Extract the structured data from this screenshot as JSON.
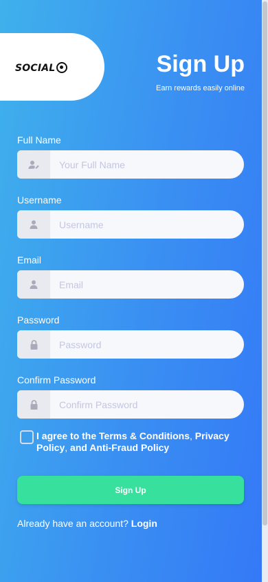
{
  "logo": {
    "text": "SOCIAL"
  },
  "header": {
    "title": "Sign Up",
    "subtitle": "Earn rewards easily online"
  },
  "form": {
    "fields": [
      {
        "label": "Full Name",
        "placeholder": "Your Full Name",
        "icon": "user-edit-icon"
      },
      {
        "label": "Username",
        "placeholder": "Username",
        "icon": "user-icon"
      },
      {
        "label": "Email",
        "placeholder": "Email",
        "icon": "user-icon"
      },
      {
        "label": "Password",
        "placeholder": "Password",
        "icon": "lock-icon"
      },
      {
        "label": "Confirm Password",
        "placeholder": "Confirm Password",
        "icon": "lock-icon"
      }
    ],
    "agree": {
      "prefix": "I agree to the ",
      "terms": "Terms & Conditions",
      "comma": ", ",
      "privacy": "Privacy Policy",
      "sep": ", ",
      "and_fraud": "and Anti-Fraud Policy"
    },
    "submit_label": "Sign Up",
    "login_prompt": "Already have an account?",
    "login_label": "Login"
  },
  "colors": {
    "background_start": "#3fb1ec",
    "background_end": "#3478f7",
    "button": "#37e09d",
    "input_bg": "#f7f8fb",
    "placeholder": "#c3c6e3"
  }
}
